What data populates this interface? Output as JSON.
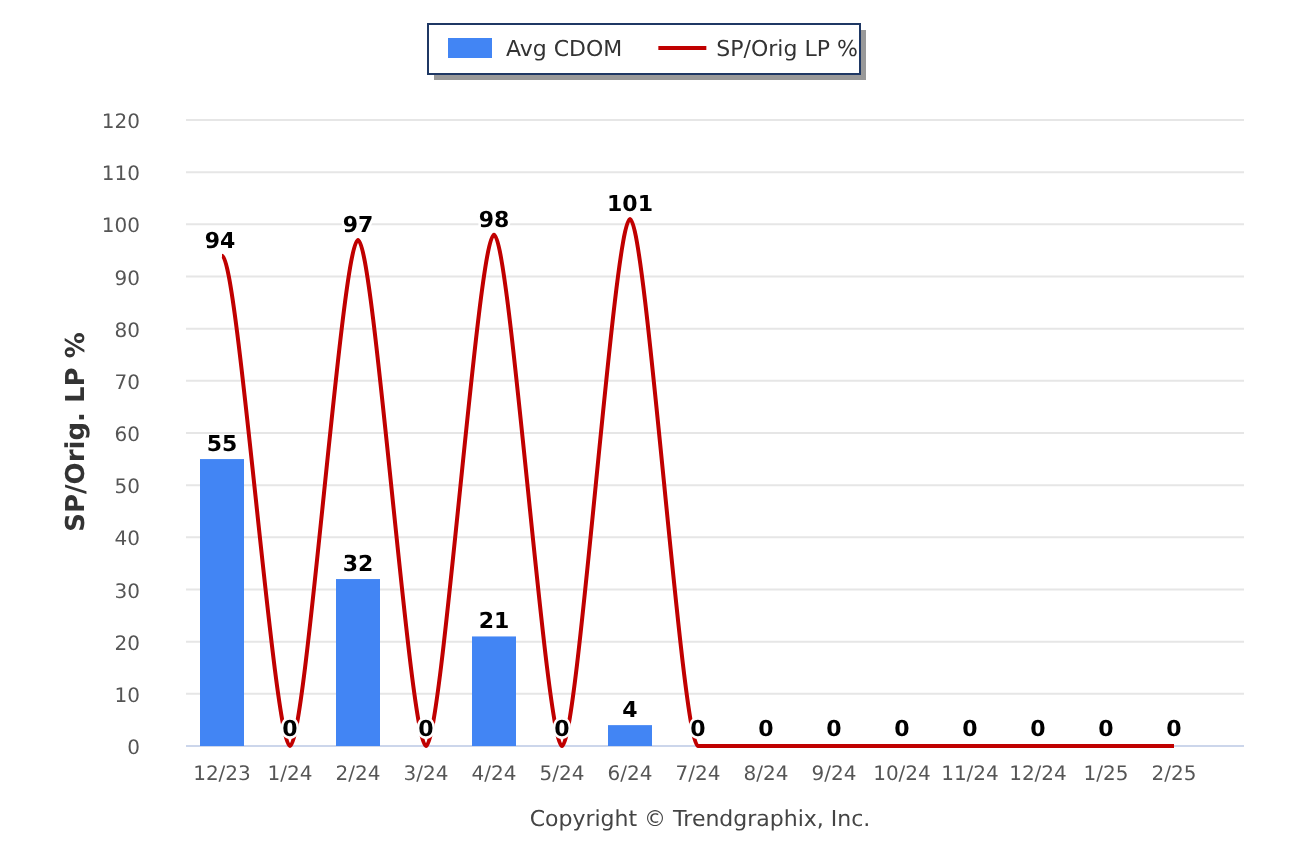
{
  "chart": {
    "chart_data": {
      "type": "bar",
      "ylabel": "SP/Orig. LP %",
      "categories": [
        "12/23",
        "1/24",
        "2/24",
        "3/24",
        "4/24",
        "5/24",
        "6/24",
        "7/24",
        "8/24",
        "9/24",
        "10/24",
        "11/24",
        "12/24",
        "1/25",
        "2/25"
      ],
      "series": [
        {
          "name": "Avg CDOM",
          "color": "#4285f4",
          "values": [
            55,
            0,
            32,
            0,
            21,
            0,
            4,
            0,
            0,
            0,
            0,
            0,
            0,
            0,
            0
          ],
          "value_labels": [
            "55",
            null,
            "32",
            null,
            "21",
            null,
            "4",
            null,
            null,
            null,
            null,
            null,
            null,
            null,
            null
          ]
        },
        {
          "name": "SP/Orig LP %",
          "type": "line",
          "color": "#c00000",
          "values": [
            94,
            0,
            97,
            0,
            98,
            0,
            101,
            0,
            0,
            0,
            0,
            0,
            0,
            0,
            0
          ],
          "value_labels": [
            "94",
            "0",
            "97",
            "0",
            "98",
            "0",
            "101",
            "0",
            "0",
            "0",
            "0",
            "0",
            "0",
            "0",
            "0"
          ]
        }
      ],
      "ylim": [
        0,
        120
      ],
      "yticks": [
        0,
        10,
        20,
        30,
        40,
        50,
        60,
        70,
        80,
        90,
        100,
        110,
        120
      ],
      "grid": true,
      "legend": true
    }
  },
  "footer": {
    "copyright": "Copyright © Trendgraphix, Inc."
  }
}
